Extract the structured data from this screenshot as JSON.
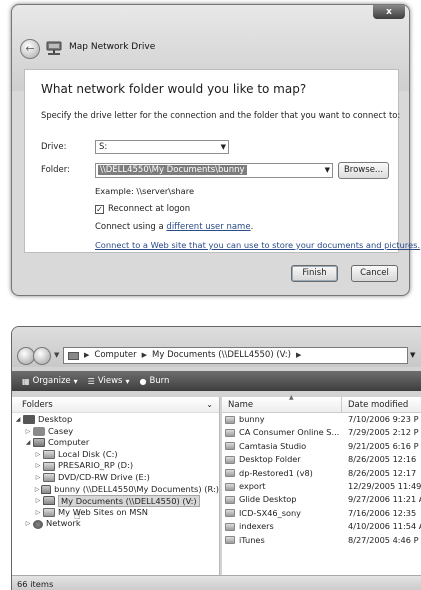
{
  "dialog": {
    "title": "Map Network Drive",
    "close_glyph": "x",
    "heading": "What network folder would you like to map?",
    "instructions": "Specify the drive letter for the connection and the folder that you want to connect to:",
    "drive_label": "Drive:",
    "drive_value": "S:",
    "folder_label": "Folder:",
    "folder_value": "\\\\DELL4550\\My Documents\\bunny",
    "browse_label": "Browse...",
    "example_text": "Example: \\\\server\\share",
    "reconnect_label": "Reconnect at logon",
    "reconnect_checked": true,
    "connect_using_prefix": "Connect using a ",
    "connect_using_link": "different user name",
    "connect_using_suffix": ".",
    "web_link": "Connect to a Web site that you can use to store your documents and pictures.",
    "finish_label": "Finish",
    "cancel_label": "Cancel"
  },
  "explorer": {
    "breadcrumbs": [
      "Computer",
      "My Documents (\\\\DELL4550) (V:)"
    ],
    "toolbar": [
      {
        "label": "Organize",
        "icon": "organize-icon"
      },
      {
        "label": "Views",
        "icon": "views-icon"
      },
      {
        "label": "Burn",
        "icon": "burn-icon"
      }
    ],
    "folders_header": "Folders",
    "tree": [
      {
        "label": "Desktop",
        "icon": "desktop-icon",
        "level": 0,
        "twisty": "expanded"
      },
      {
        "label": "Casey",
        "icon": "user-folder-icon",
        "level": 1,
        "twisty": "collapsed"
      },
      {
        "label": "Computer",
        "icon": "computer-icon",
        "level": 1,
        "twisty": "expanded"
      },
      {
        "label": "Local Disk (C:)",
        "icon": "drive-icon",
        "level": 2,
        "twisty": "collapsed"
      },
      {
        "label": "PRESARIO_RP (D:)",
        "icon": "drive-icon",
        "level": 2,
        "twisty": "collapsed"
      },
      {
        "label": "DVD/CD-RW Drive (E:)",
        "icon": "dvd-drive-icon",
        "level": 2,
        "twisty": "collapsed"
      },
      {
        "label": "bunny (\\\\DELL4550\\My Documents) (R:)",
        "icon": "network-drive-icon",
        "level": 2,
        "twisty": "collapsed"
      },
      {
        "label": "My Documents (\\\\DELL4550) (V:)",
        "icon": "network-drive-icon",
        "level": 2,
        "twisty": "collapsed",
        "highlighted": true
      },
      {
        "label": "My Web Sites on MSN",
        "icon": "web-sites-icon",
        "level": 2,
        "twisty": "collapsed"
      },
      {
        "label": "Network",
        "icon": "network-icon",
        "level": 1,
        "twisty": "collapsed"
      }
    ],
    "columns": {
      "name": "Name",
      "date": "Date modified"
    },
    "files": [
      {
        "name": "bunny",
        "date": "7/10/2006 9:23 P"
      },
      {
        "name": "CA Consumer Online S...",
        "date": "7/29/2005 2:12 P"
      },
      {
        "name": "Camtasia Studio",
        "date": "9/21/2005 6:16 P"
      },
      {
        "name": "Desktop Folder",
        "date": "8/26/2005 12:16"
      },
      {
        "name": "dp-Restored1 (v8)",
        "date": "8/26/2005 12:17"
      },
      {
        "name": "export",
        "date": "12/29/2005 11:49"
      },
      {
        "name": "Glide Desktop",
        "date": "9/27/2006 11:21 A"
      },
      {
        "name": "ICD-SX46_sony",
        "date": "7/16/2006 12:35"
      },
      {
        "name": "indexers",
        "date": "4/10/2006 11:54 A"
      },
      {
        "name": "iTunes",
        "date": "8/27/2005 4:46 P"
      }
    ],
    "status": "66 items"
  }
}
